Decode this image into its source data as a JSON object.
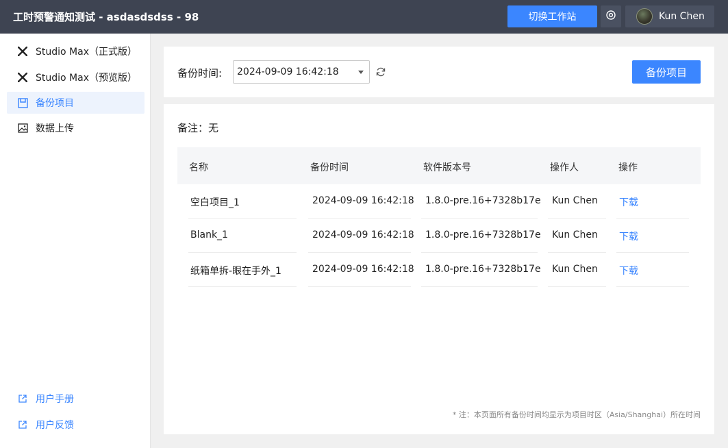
{
  "header": {
    "title": "工时预警通知测试 - asdasdsdss - 98",
    "switch_label": "切换工作站",
    "user_name": "Kun Chen"
  },
  "sidebar": {
    "items": [
      {
        "label": "Studio Max（正式版）",
        "icon": "studio-max-icon"
      },
      {
        "label": "Studio Max（预览版）",
        "icon": "studio-max-icon"
      },
      {
        "label": "备份项目",
        "icon": "backup-icon",
        "active": true
      },
      {
        "label": "数据上传",
        "icon": "image-upload-icon"
      }
    ],
    "links": [
      {
        "label": "用户手册",
        "icon": "external-link-icon"
      },
      {
        "label": "用户反馈",
        "icon": "external-link-icon"
      }
    ]
  },
  "toolbar": {
    "time_label": "备份时间:",
    "time_value": "2024-09-09 16:42:18",
    "backup_label": "备份项目"
  },
  "main": {
    "note": "备注：无",
    "columns": [
      "名称",
      "备份时间",
      "软件版本号",
      "操作人",
      "操作"
    ],
    "rows": [
      {
        "name": "空白项目_1",
        "time": "2024-09-09 16:42:18",
        "version": "1.8.0-pre.16+7328b17e",
        "operator": "Kun Chen",
        "action": "下载"
      },
      {
        "name": "Blank_1",
        "time": "2024-09-09 16:42:18",
        "version": "1.8.0-pre.16+7328b17e",
        "operator": "Kun Chen",
        "action": "下载"
      },
      {
        "name": "纸箱单拆-眼在手外_1",
        "time": "2024-09-09 16:42:18",
        "version": "1.8.0-pre.16+7328b17e",
        "operator": "Kun Chen",
        "action": "下载"
      }
    ],
    "footnote": "* 注：本页面所有备份时间均显示为项目时区（Asia/Shanghai）所在时间"
  },
  "colors": {
    "accent": "#3b86ff",
    "topbar": "#3e4452",
    "active_bg": "#edf3fd"
  }
}
